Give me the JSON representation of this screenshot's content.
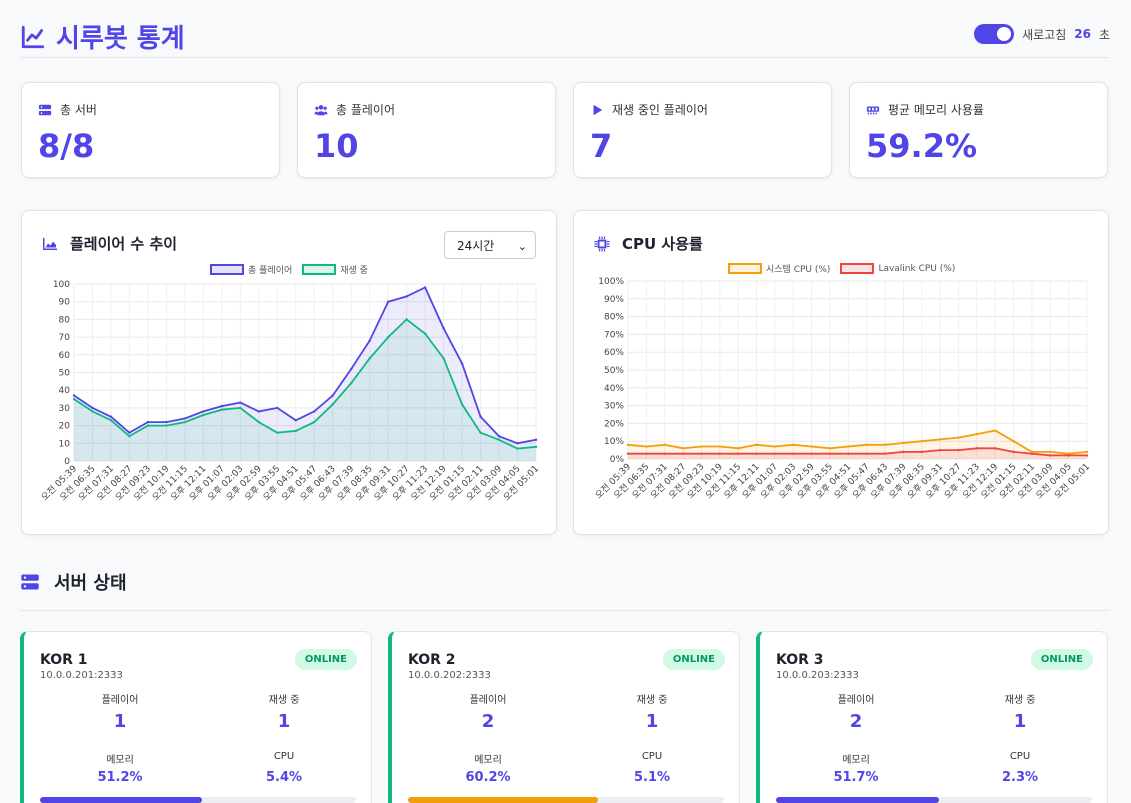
{
  "header": {
    "title": "시루봇 통계",
    "refresh_label": "새로고침",
    "refresh_seconds": "26",
    "refresh_unit": "초",
    "auto_refresh_on": true
  },
  "stats": [
    {
      "label": "총 서버",
      "value": "8/8",
      "icon": "server-icon"
    },
    {
      "label": "총 플레이어",
      "value": "10",
      "icon": "users-icon"
    },
    {
      "label": "재생 중인 플레이어",
      "value": "7",
      "icon": "play-icon"
    },
    {
      "label": "평균 메모리 사용률",
      "value": "59.2%",
      "icon": "memory-icon"
    }
  ],
  "players_chart": {
    "title": "플레이어 수 추이",
    "range_selected": "24시간",
    "legend_total": "총 플레이어",
    "legend_playing": "재생 중",
    "colors": {
      "total": "#4f46e5",
      "playing": "#10b981"
    }
  },
  "cpu_chart": {
    "title": "CPU 사용률",
    "legend_system": "시스템 CPU (%)",
    "legend_lavalink": "Lavalink CPU (%)",
    "colors": {
      "system": "#f59e0b",
      "lavalink": "#ef4444"
    }
  },
  "chart_data": [
    {
      "type": "line",
      "title": "플레이어 수 추이",
      "ylim": [
        0,
        100
      ],
      "yticks": [
        0,
        10,
        20,
        30,
        40,
        50,
        60,
        70,
        80,
        90,
        100
      ],
      "categories": [
        "오전 05:39",
        "오전 06:35",
        "오전 07:31",
        "오전 08:27",
        "오전 09:23",
        "오전 10:19",
        "오전 11:15",
        "오후 12:11",
        "오후 01:07",
        "오후 02:03",
        "오후 02:59",
        "오후 03:55",
        "오후 04:51",
        "오후 05:47",
        "오후 06:43",
        "오후 07:39",
        "오후 08:35",
        "오후 09:31",
        "오후 10:27",
        "오후 11:23",
        "오전 12:19",
        "오전 01:15",
        "오전 02:11",
        "오전 03:09",
        "오전 04:05",
        "오전 05:01"
      ],
      "series": [
        {
          "name": "총 플레이어",
          "values": [
            37,
            30,
            25,
            16,
            22,
            22,
            24,
            28,
            31,
            33,
            28,
            30,
            23,
            28,
            37,
            52,
            68,
            90,
            93,
            98,
            75,
            55,
            25,
            14,
            10,
            12
          ]
        },
        {
          "name": "재생 중",
          "values": [
            35,
            28,
            23,
            14,
            20,
            20,
            22,
            26,
            29,
            30,
            22,
            16,
            17,
            22,
            32,
            44,
            58,
            70,
            80,
            72,
            58,
            32,
            16,
            12,
            7,
            8
          ]
        }
      ]
    },
    {
      "type": "line",
      "title": "CPU 사용률",
      "ylim": [
        0,
        100
      ],
      "yticks": [
        "0%",
        "10%",
        "20%",
        "30%",
        "40%",
        "50%",
        "60%",
        "70%",
        "80%",
        "90%",
        "100%"
      ],
      "categories": [
        "오전 05:39",
        "오전 06:35",
        "오전 07:31",
        "오전 08:27",
        "오전 09:23",
        "오전 10:19",
        "오전 11:15",
        "오후 12:11",
        "오후 01:07",
        "오후 02:03",
        "오후 02:59",
        "오후 03:55",
        "오후 04:51",
        "오후 05:47",
        "오후 06:43",
        "오후 07:39",
        "오후 08:35",
        "오후 09:31",
        "오후 10:27",
        "오후 11:23",
        "오전 12:19",
        "오전 01:15",
        "오전 02:11",
        "오전 03:09",
        "오전 04:05",
        "오전 05:01"
      ],
      "series": [
        {
          "name": "시스템 CPU (%)",
          "values": [
            8,
            7,
            8,
            6,
            7,
            7,
            6,
            8,
            7,
            8,
            7,
            6,
            7,
            8,
            8,
            9,
            10,
            11,
            12,
            14,
            16,
            10,
            4,
            4,
            3,
            4
          ]
        },
        {
          "name": "Lavalink CPU (%)",
          "values": [
            3,
            3,
            3,
            3,
            3,
            3,
            3,
            3,
            3,
            3,
            3,
            3,
            3,
            3,
            3,
            4,
            4,
            5,
            5,
            6,
            6,
            4,
            3,
            2,
            2,
            2
          ]
        }
      ]
    }
  ],
  "servers_section": {
    "title": "서버 상태"
  },
  "servers": [
    {
      "name": "KOR 1",
      "address": "10.0.0.201:2333",
      "status": "ONLINE",
      "players_label": "플레이어",
      "players": "1",
      "playing_label": "재생 중",
      "playing": "1",
      "memory_label": "메모리",
      "memory": "51.2%",
      "cpu_label": "CPU",
      "cpu": "5.4%",
      "memory_fraction": 0.512,
      "bar_color": "#4f46e5"
    },
    {
      "name": "KOR 2",
      "address": "10.0.0.202:2333",
      "status": "ONLINE",
      "players_label": "플레이어",
      "players": "2",
      "playing_label": "재생 중",
      "playing": "1",
      "memory_label": "메모리",
      "memory": "60.2%",
      "cpu_label": "CPU",
      "cpu": "5.1%",
      "memory_fraction": 0.602,
      "bar_color": "#f59e0b"
    },
    {
      "name": "KOR 3",
      "address": "10.0.0.203:2333",
      "status": "ONLINE",
      "players_label": "플레이어",
      "players": "2",
      "playing_label": "재생 중",
      "playing": "1",
      "memory_label": "메모리",
      "memory": "51.7%",
      "cpu_label": "CPU",
      "cpu": "2.3%",
      "memory_fraction": 0.517,
      "bar_color": "#4f46e5"
    }
  ]
}
